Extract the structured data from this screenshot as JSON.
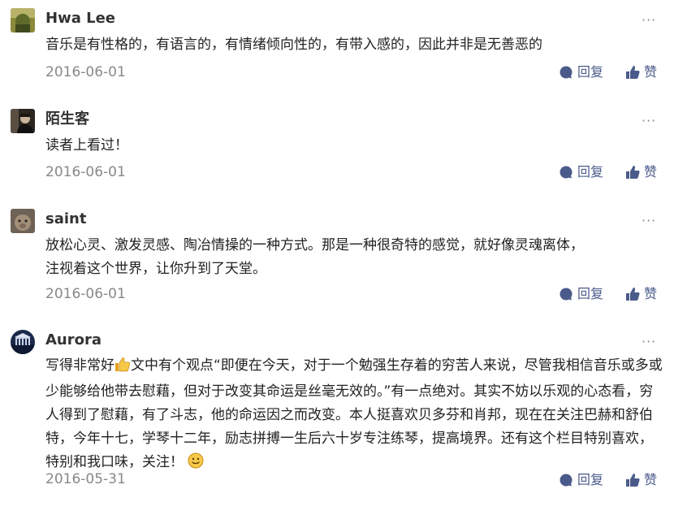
{
  "comments": [
    {
      "author": "Hwa Lee",
      "text": "音乐是有性格的，有语言的，有情绪倾向性的，有带入感的，因此并非是无善恶的",
      "date": "2016-06-01",
      "avatar_icon": "landscape-avatar-icon"
    },
    {
      "author": "陌生客",
      "text": "读者上看过！",
      "date": "2016-06-01",
      "avatar_icon": "person-avatar-icon"
    },
    {
      "author": "saint",
      "text_line1": "放松心灵、激发灵感、陶冶情操的一种方式。那是一种很奇特的感觉，就好像灵魂离体，",
      "text_line2": "注视着这个世界，让你升到了天堂。",
      "date": "2016-06-01",
      "avatar_icon": "animal-avatar-icon"
    },
    {
      "author": "Aurora",
      "text_part1": "写得非常好",
      "text_part2": "文中有个观点“即便在今天，对于一个勉强生存着的穷苦人来说，尽管我相信音乐或多或少能够给他带去慰藉，但对于改变其命运是丝毫无效的。”有一点绝对。其实不妨以乐观的心态看，穷人得到了慰藉，有了斗志，他的命运因之而改变。本人挺喜欢贝多芬和肖邦，现在在关注巴赫和舒伯特，今年十七，学琴十二年，励志拼搏一生后六十岁专注练琴，提高境界。还有这个栏目特别喜欢，特别和我口味，关注！",
      "date": "2016-05-31",
      "avatar_icon": "building-avatar-icon"
    }
  ],
  "actions": {
    "more_label": "···",
    "reply_label": "回复",
    "like_label": "赞"
  },
  "colors": {
    "action_blue": "#4a5a8a",
    "muted_gray": "#888888"
  }
}
